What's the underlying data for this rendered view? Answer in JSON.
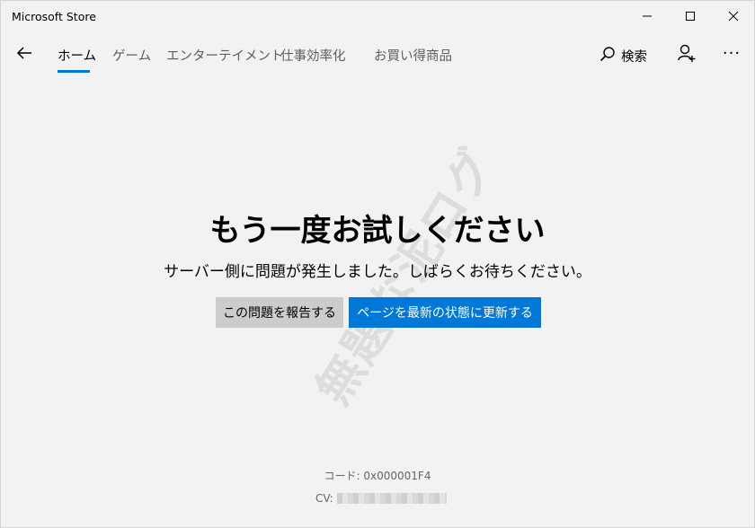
{
  "window": {
    "title": "Microsoft Store",
    "controls": {
      "minimize": "minimize-icon",
      "maximize": "maximize-icon",
      "close": "close-icon"
    }
  },
  "nav": {
    "back_icon": "back-arrow-icon",
    "tabs": [
      {
        "label": "ホーム",
        "active": true
      },
      {
        "label": "ゲーム",
        "active": false
      },
      {
        "label": "エンターテイメント",
        "active": false
      },
      {
        "label": "仕事効率化",
        "active": false
      },
      {
        "label": "お買い得商品",
        "active": false
      }
    ],
    "search_label": "検索",
    "search_icon": "search-icon",
    "account_icon": "account-add-icon",
    "more_label": "···",
    "accent_color": "#0078d7"
  },
  "error": {
    "headline": "もう一度お試しください",
    "message": "サーバー側に問題が発生しました。しばらくお待ちください。",
    "report_button": "この問題を報告する",
    "refresh_button": "ページを最新の状態に更新する",
    "code_line": "コード: 0x000001F4",
    "cv_label": "CV:"
  },
  "watermark": {
    "text": "無題な泥ログ"
  }
}
